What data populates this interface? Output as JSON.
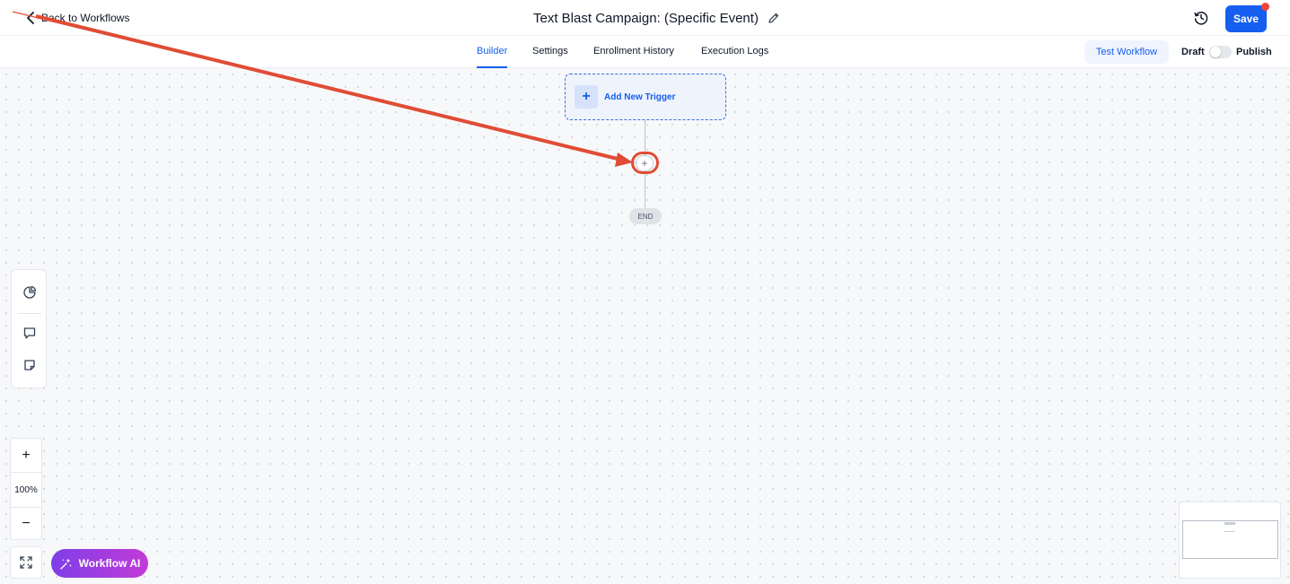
{
  "header": {
    "back_label": "Back to Workflows",
    "title": "Text Blast Campaign: (Specific Event)",
    "save_label": "Save"
  },
  "subnav": {
    "tabs": [
      {
        "label": "Builder",
        "active": true
      },
      {
        "label": "Settings",
        "active": false
      },
      {
        "label": "Enrollment History",
        "active": false
      },
      {
        "label": "Execution Logs",
        "active": false
      }
    ],
    "test_label": "Test Workflow",
    "draft_label": "Draft",
    "publish_label": "Publish",
    "published": false
  },
  "canvas": {
    "trigger_label": "Add New Trigger",
    "add_step_symbol": "+",
    "end_label": "END"
  },
  "tools": {
    "zoom_in": "+",
    "zoom_level": "100%",
    "zoom_out": "−",
    "ai_label": "Workflow AI"
  },
  "icons": [
    "back-chevron-icon",
    "pencil-icon",
    "history-clock-icon",
    "pie-chart-icon",
    "comment-icon",
    "sticky-note-icon",
    "fit-to-screen-icon",
    "sparkles-icon"
  ],
  "colors": {
    "primary": "#155eef",
    "notification": "#f04438",
    "annotation": "#e04c35",
    "ai_gradient_start": "#7f3ee8",
    "ai_gradient_end": "#c13bd6"
  }
}
